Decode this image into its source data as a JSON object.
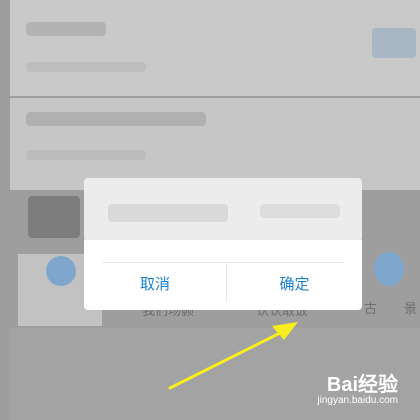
{
  "dialog": {
    "cancel_label": "取消",
    "confirm_label": "确定"
  },
  "background": {
    "fragment_left": "我们场颢",
    "fragment_right": "认认敢饭",
    "fragment_edge_1": "古",
    "fragment_edge_2": "景"
  },
  "watermark": {
    "brand": "Bai经验",
    "url": "jingyan.baidu.com"
  },
  "colors": {
    "accent": "#1b7fd6",
    "arrow": "#f7ee1e",
    "overlay": "#9e9e9e"
  }
}
